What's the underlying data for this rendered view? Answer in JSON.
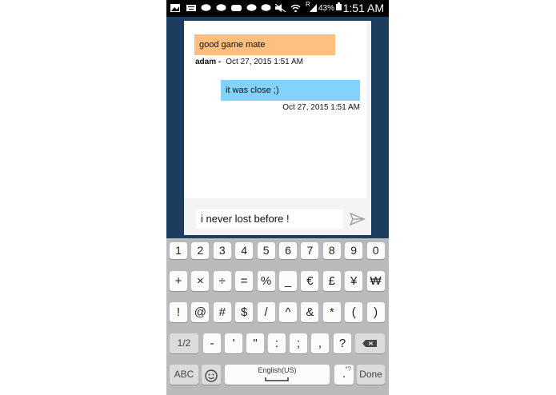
{
  "status_bar": {
    "time": "1:51 AM",
    "battery_pct": "43%",
    "carrier_indicator": "R",
    "icons": [
      "photo-icon",
      "keyboard-icon",
      "chat-icon",
      "chat-icon",
      "gamepad-icon",
      "chat-icon",
      "chat-icon",
      "mute-icon",
      "wifi-icon",
      "signal-icon",
      "battery-icon"
    ]
  },
  "chat": {
    "messages": [
      {
        "text": "good game mate",
        "author": "adam -",
        "timestamp": "Oct 27, 2015 1:51 AM",
        "color": "#ffc07f"
      },
      {
        "text": "it was close ;)",
        "timestamp": "Oct 27, 2015 1:51 AM",
        "color": "#82d3fb"
      }
    ],
    "compose_value": "i never lost before !"
  },
  "keyboard": {
    "number_row": [
      "1",
      "2",
      "3",
      "4",
      "5",
      "6",
      "7",
      "8",
      "9",
      "0"
    ],
    "row1": [
      "+",
      "×",
      "÷",
      "=",
      "%",
      "_",
      "€",
      "£",
      "¥",
      "₩"
    ],
    "row2": [
      "!",
      "@",
      "#",
      "$",
      "/",
      "^",
      "&",
      "*",
      "(",
      ")"
    ],
    "row3": [
      "1/2",
      "-",
      "'",
      "\"",
      ":",
      ";",
      ",",
      "?"
    ],
    "row4": {
      "abc": "ABC",
      "space": "English(US)",
      "period": ".",
      "period_hint": "*?",
      "done": "Done"
    }
  },
  "colors": {
    "background": "#1c3d5e",
    "keyboard": "#b8babc"
  }
}
